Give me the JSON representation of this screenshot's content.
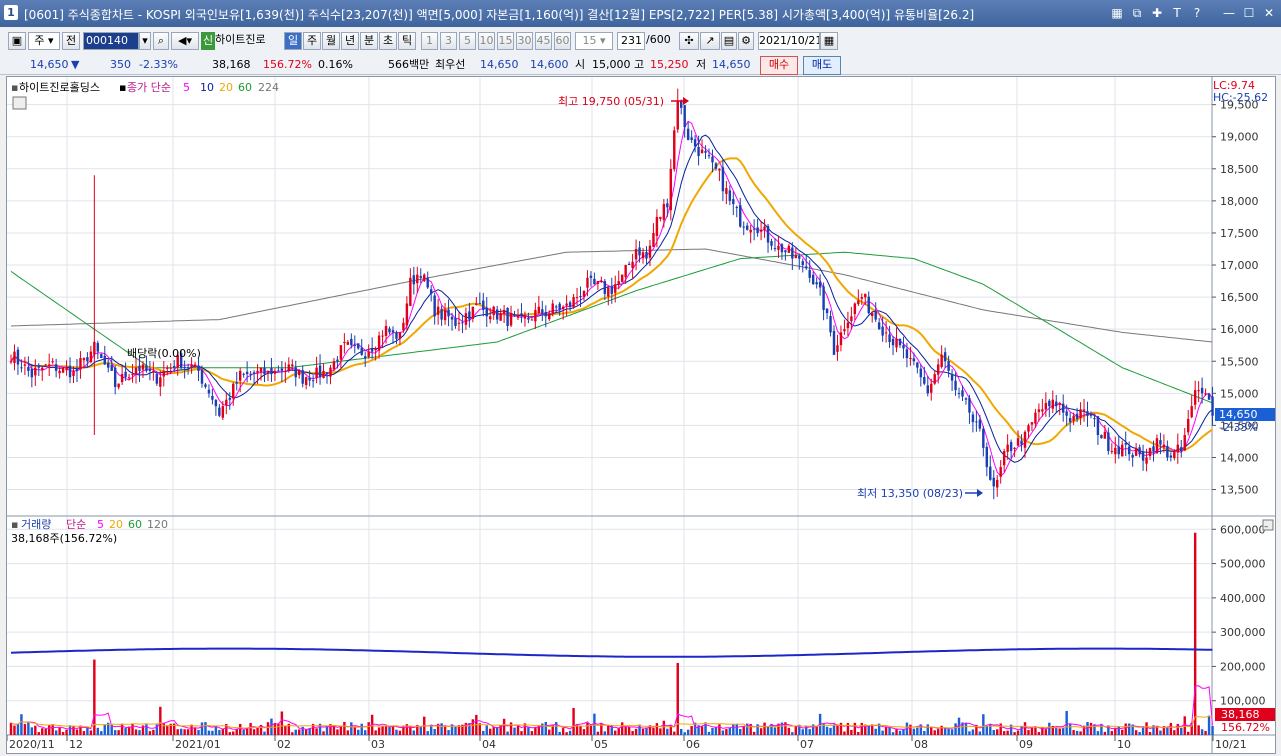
{
  "window": {
    "badge": "1",
    "title": "[0601] 주식종합차트 - KOSPI 외국인보유[1,639(천)] 주식수[23,207(천)] 액면[5,000] 자본금[1,160(억)] 결산[12월] EPS[2,722] PER[5.38] 시가총액[3,400(억)] 유통비율[26.2]",
    "icons": [
      "grid-icon",
      "copy-icon",
      "pin-icon",
      "text-icon",
      "help-icon",
      "minimize-icon",
      "maximize-icon",
      "close-icon"
    ],
    "icon_glyphs": [
      "▦",
      "⧉",
      "✚",
      "T",
      "?",
      "—",
      "☐",
      "✕"
    ]
  },
  "toolbar": {
    "market": "주",
    "prev_label": "전",
    "stock_code": "000140",
    "new_badge": "신",
    "stock_name": "하이트진로",
    "periods": [
      "일",
      "주",
      "월",
      "년",
      "분",
      "초",
      "틱"
    ],
    "selected_period": "일",
    "minute_steps": [
      "1",
      "3",
      "5",
      "10",
      "15",
      "30",
      "45",
      "60"
    ],
    "interval_select": "15",
    "count_current": "231",
    "count_total": "/600",
    "date": "2021/10/21"
  },
  "quote": {
    "price": "14,650",
    "change_arrow": "▼",
    "change": "350",
    "change_rate": "-2.33%",
    "volume": "38,168",
    "volume_ratio": "156.72%",
    "turnover": "0.16%",
    "amount": "566백만",
    "preferred_label": "최우선",
    "ask": "14,650",
    "bid": "14,600",
    "open_label": "시",
    "open": "15,000",
    "high_label": "고",
    "high": "15,250",
    "low_label": "저",
    "low": "14,650",
    "buy_label": "매수",
    "sell_label": "매도"
  },
  "price_panel": {
    "legend_name": "하이트진로홀딩스",
    "legend_indicator": "종가 단순",
    "ma_periods": [
      "5",
      "10",
      "20",
      "60",
      "224"
    ],
    "ma_colors": [
      "#ff00ff",
      "#0a1f9c",
      "#f0a800",
      "#1e9a3a",
      "#777777"
    ],
    "lc": "LC:9.74",
    "hc": "HC:-25.62",
    "max_annot": "최고 19,750 (05/31)",
    "min_annot": "최저 13,350 (08/23)",
    "dividend_annot": "배당락(0.00%)",
    "last_price_label": "14,650",
    "last_change_label": "-2.33%",
    "y_ticks": [
      "19,500",
      "19,000",
      "18,500",
      "18,000",
      "17,500",
      "17,000",
      "16,500",
      "16,000",
      "15,500",
      "15,000",
      "14,500",
      "14,000",
      "13,500"
    ]
  },
  "volume_panel": {
    "legend_name": "거래량",
    "legend_indicator": "단순",
    "ma_periods": [
      "5",
      "20",
      "60",
      "120"
    ],
    "info": "38,168주(156.72%)",
    "last_volume_label": "38,168",
    "last_ratio_label": "156.72%",
    "y_ticks": [
      "600,000",
      "500,000",
      "400,000",
      "300,000",
      "200,000",
      "100,000"
    ]
  },
  "x_axis_labels": [
    "2020/11",
    "12",
    "2021/01",
    "02",
    "03",
    "04",
    "05",
    "06",
    "07",
    "08",
    "09",
    "10",
    "10/21"
  ],
  "chart_data": {
    "type": "candlestick",
    "ylim": [
      13150,
      19900
    ],
    "volume_ylim": [
      0,
      630000
    ],
    "max": {
      "value": 19750,
      "date": "05/31"
    },
    "min": {
      "value": 13350,
      "date": "08/23"
    },
    "close_anchors": [
      [
        0,
        15600
      ],
      [
        6,
        15300
      ],
      [
        12,
        15450
      ],
      [
        18,
        15300
      ],
      [
        24,
        15700
      ],
      [
        30,
        15150
      ],
      [
        36,
        15400
      ],
      [
        42,
        15250
      ],
      [
        48,
        15500
      ],
      [
        54,
        15350
      ],
      [
        60,
        14700
      ],
      [
        66,
        15250
      ],
      [
        72,
        15300
      ],
      [
        80,
        15400
      ],
      [
        84,
        15250
      ],
      [
        90,
        15300
      ],
      [
        96,
        15700
      ],
      [
        102,
        15650
      ],
      [
        108,
        16000
      ],
      [
        112,
        15850
      ],
      [
        115,
        16700
      ],
      [
        118,
        16900
      ],
      [
        122,
        16300
      ],
      [
        128,
        16100
      ],
      [
        134,
        16350
      ],
      [
        140,
        16250
      ],
      [
        146,
        16100
      ],
      [
        152,
        16250
      ],
      [
        160,
        16350
      ],
      [
        166,
        16700
      ],
      [
        172,
        16600
      ],
      [
        176,
        16800
      ],
      [
        180,
        17250
      ],
      [
        183,
        17100
      ],
      [
        186,
        17700
      ],
      [
        189,
        18000
      ],
      [
        192,
        19600
      ],
      [
        195,
        19000
      ],
      [
        198,
        18800
      ],
      [
        201,
        18600
      ],
      [
        204,
        18400
      ],
      [
        207,
        18000
      ],
      [
        210,
        17700
      ],
      [
        215,
        17600
      ],
      [
        220,
        17300
      ],
      [
        226,
        17100
      ],
      [
        230,
        16900
      ],
      [
        234,
        16400
      ],
      [
        237,
        15700
      ],
      [
        241,
        16200
      ],
      [
        245,
        16500
      ],
      [
        250,
        16100
      ],
      [
        256,
        15700
      ],
      [
        260,
        15400
      ],
      [
        264,
        15050
      ],
      [
        268,
        15600
      ],
      [
        272,
        15000
      ],
      [
        276,
        14700
      ],
      [
        280,
        14200
      ],
      [
        283,
        13450
      ],
      [
        287,
        14150
      ],
      [
        292,
        14300
      ],
      [
        296,
        14750
      ],
      [
        301,
        14850
      ],
      [
        305,
        14600
      ],
      [
        310,
        14700
      ],
      [
        316,
        14200
      ],
      [
        320,
        14150
      ],
      [
        326,
        14000
      ],
      [
        330,
        14250
      ],
      [
        334,
        14050
      ],
      [
        337,
        14100
      ],
      [
        341,
        15000
      ],
      [
        344,
        15100
      ],
      [
        346,
        14650
      ]
    ],
    "ma60_anchors": [
      [
        0,
        16900
      ],
      [
        40,
        15400
      ],
      [
        80,
        15400
      ],
      [
        140,
        15800
      ],
      [
        180,
        16600
      ],
      [
        210,
        17100
      ],
      [
        240,
        17200
      ],
      [
        260,
        17100
      ],
      [
        280,
        16700
      ],
      [
        300,
        16050
      ],
      [
        320,
        15400
      ],
      [
        346,
        14850
      ]
    ],
    "ma224_anchors": [
      [
        0,
        16050
      ],
      [
        60,
        16150
      ],
      [
        120,
        16800
      ],
      [
        160,
        17200
      ],
      [
        200,
        17250
      ],
      [
        240,
        16850
      ],
      [
        280,
        16300
      ],
      [
        320,
        15950
      ],
      [
        346,
        15800
      ]
    ],
    "volume_ma_level": 240000,
    "volume_spikes": [
      [
        24,
        220000
      ],
      [
        192,
        210000
      ],
      [
        341,
        590000
      ]
    ]
  }
}
